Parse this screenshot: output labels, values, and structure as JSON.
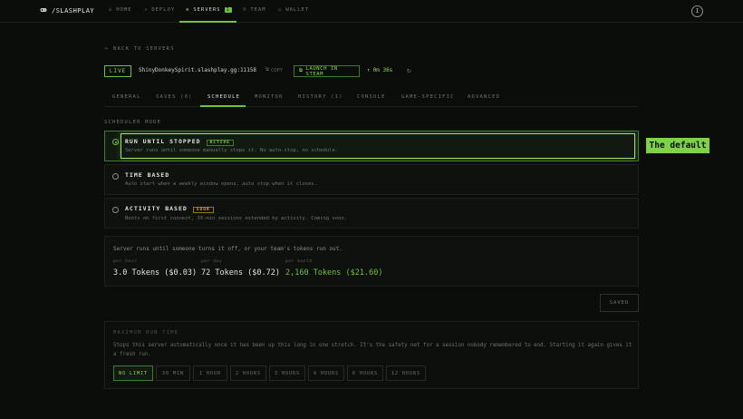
{
  "brand": {
    "name": "/SLASHPLAY"
  },
  "nav": {
    "items": [
      {
        "label": "HOME"
      },
      {
        "label": "DEPLOY"
      },
      {
        "label": "SERVERS",
        "count": "1"
      },
      {
        "label": "TEAM"
      },
      {
        "label": "WALLET"
      }
    ],
    "user_initial": "I"
  },
  "server": {
    "back_label": "BACK TO SERVERS",
    "status": "LIVE",
    "address": "ShinyDonkeySpirit.slashplay.gg:11158",
    "copy_label": "COPY",
    "steam_label": "LAUNCH IN STEAM",
    "uptime": "0m 36s"
  },
  "tabs": [
    {
      "label": "GENERAL"
    },
    {
      "label": "SAVES (0)"
    },
    {
      "label": "SCHEDULE"
    },
    {
      "label": "MONITOR"
    },
    {
      "label": "HISTORY (1)"
    },
    {
      "label": "CONSOLE"
    },
    {
      "label": "GAME-SPECIFIC"
    },
    {
      "label": "ADVANCED"
    }
  ],
  "scheduler": {
    "section_label": "SCHEDULER MODE",
    "modes": [
      {
        "title": "RUN UNTIL STOPPED",
        "badge": "ACTIVE",
        "desc": "Server runs until someone manually stops it. No auto-stop, no schedule."
      },
      {
        "title": "TIME BASED",
        "desc": "Auto start when a weekly window opens, auto stop when it closes."
      },
      {
        "title": "ACTIVITY BASED",
        "badge": "SOON",
        "desc": "Boots on first connect, 30-min sessions extended by activity. Coming soon."
      }
    ],
    "callout": "The default"
  },
  "cost": {
    "note": "Server runs until someone turns it off, or your team's tokens run out.",
    "per_hour_label": "per hour",
    "per_hour_value": "3.0 Tokens ($0.03)",
    "per_day_label": "per day",
    "per_day_value": "72 Tokens ($0.72)",
    "per_month_label": "per month",
    "per_month_value": "2,160 Tokens ($21.60)"
  },
  "saved_label": "SAVED",
  "max_run": {
    "label": "MAXIMUM RUN TIME",
    "desc": "Stops this server automatically once it has been up this long in one stretch. It's the safety net for a session nobody remembered to end. Starting it again gives it a fresh run.",
    "options": [
      "NO LIMIT",
      "30 MIN",
      "1 HOUR",
      "2 HOURS",
      "3 HOURS",
      "4 HOURS",
      "6 HOURS",
      "12 HOURS"
    ],
    "selected": "NO LIMIT"
  },
  "colors": {
    "accent": "#6ec23e",
    "background": "#0b0d0b",
    "soon": "#d6a431"
  }
}
